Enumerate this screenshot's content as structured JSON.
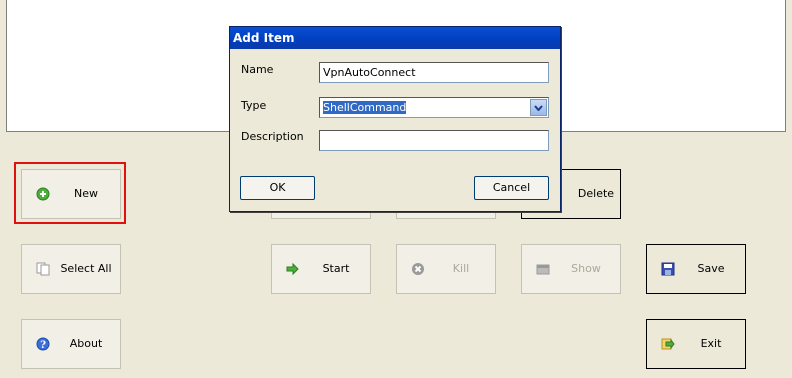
{
  "buttons": {
    "new": "New",
    "delete": "Delete",
    "select_all": "Select All",
    "start": "Start",
    "kill": "Kill",
    "show": "Show",
    "save": "Save",
    "about": "About",
    "exit": "Exit"
  },
  "dialog": {
    "title": "Add Item",
    "name_label": "Name",
    "name_value": "VpnAutoConnect",
    "type_label": "Type",
    "type_value": "ShellCommand",
    "description_label": "Description",
    "description_value": "",
    "ok_label": "OK",
    "cancel_label": "Cancel"
  },
  "colors": {
    "focus": "#e01010",
    "title_bar": "#0a4fd6",
    "selection": "#316ac5"
  },
  "icons": {
    "new": "green-plus-circle-icon",
    "select_all": "copy-pages-icon",
    "start": "green-arrow-icon",
    "kill": "gray-x-circle-icon",
    "show": "window-icon",
    "save": "floppy-disk-icon",
    "about": "blue-info-circle-icon",
    "exit": "exit-door-arrow-icon"
  }
}
